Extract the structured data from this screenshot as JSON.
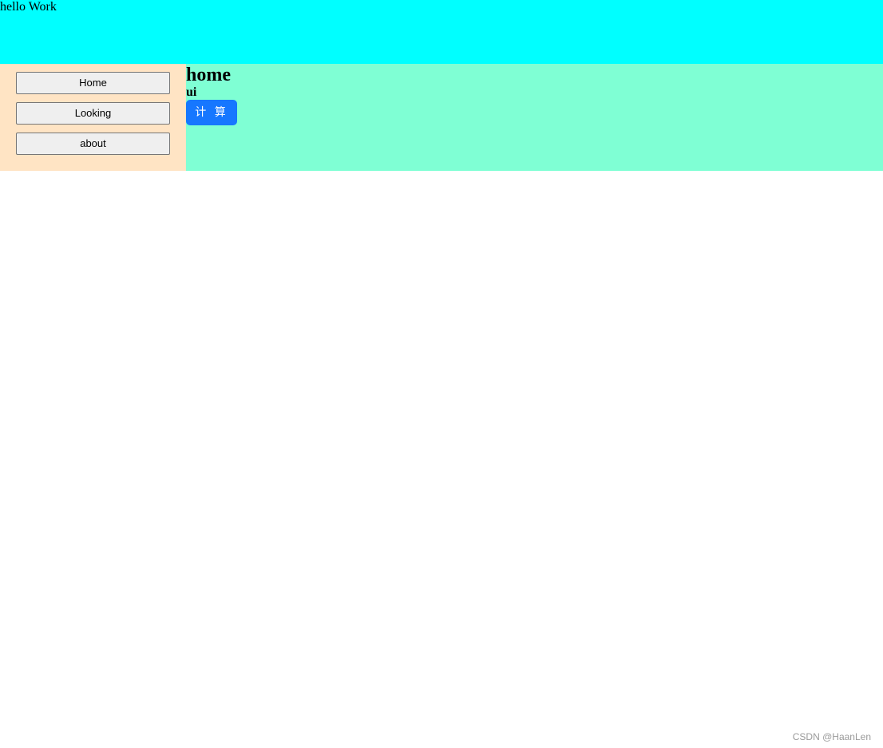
{
  "header": {
    "text": "hello Work",
    "background": "#00ffff"
  },
  "sidebar": {
    "background": "#ffe4c4",
    "items": [
      {
        "label": "Home"
      },
      {
        "label": "Looking"
      },
      {
        "label": "about"
      }
    ]
  },
  "main": {
    "background": "#7fffd4",
    "title": "home",
    "subtitle": "ui",
    "button_label": "计 算",
    "button_color": "#1677ff"
  },
  "watermark": {
    "text": "CSDN @HaanLen"
  }
}
